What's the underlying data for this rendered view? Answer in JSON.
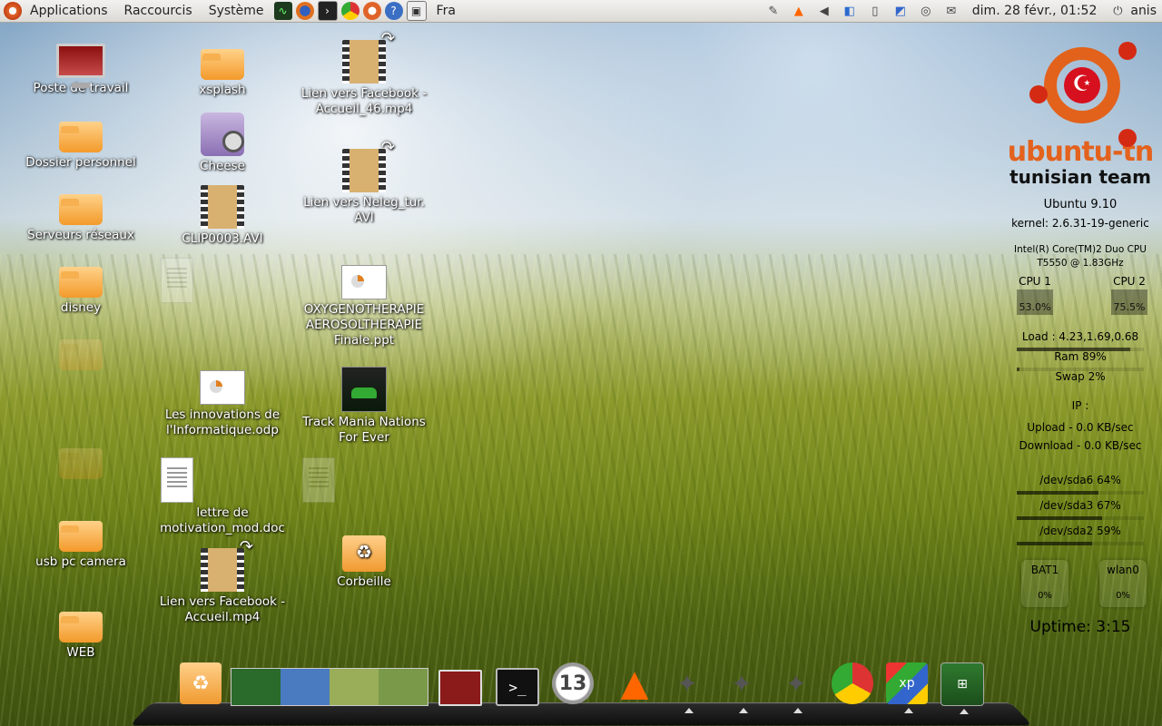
{
  "panel": {
    "menus": [
      "Applications",
      "Raccourcis",
      "Système"
    ],
    "launchers": [
      "system-monitor-icon",
      "firefox-icon",
      "terminal-icon",
      "chrome-icon",
      "ubuntu-tweak-icon",
      "help-icon",
      "screenshot-icon"
    ],
    "lang": "Fra",
    "datetime": "dim. 28 févr., 01:52",
    "user": "anis"
  },
  "desktop": {
    "icons": [
      {
        "label": "Poste de travail",
        "name": "computer-icon"
      },
      {
        "label": "Dossier personnel",
        "name": "home-folder-icon"
      },
      {
        "label": "Serveurs réseaux",
        "name": "network-folder-icon"
      },
      {
        "label": "disney",
        "name": "folder-icon"
      },
      {
        "label": "usb pc camera",
        "name": "folder-icon"
      },
      {
        "label": "WEB",
        "name": "folder-icon"
      },
      {
        "label": "xsplash",
        "name": "folder-icon"
      },
      {
        "label": "Cheese",
        "name": "webcam-icon"
      },
      {
        "label": "CLIP0003.AVI",
        "name": "video-icon"
      },
      {
        "label": "Les innovations de l'Informatique.odp",
        "name": "presentation-icon"
      },
      {
        "label": "lettre de motivation_mod.doc",
        "name": "document-icon"
      },
      {
        "label": "Lien vers Facebook - Accueil.mp4",
        "name": "video-link-icon"
      },
      {
        "label": "Lien vers Facebook - Accueil_46.mp4",
        "name": "video-link-icon"
      },
      {
        "label": "Lien vers Neleg_tur. AVI",
        "name": "video-link-icon"
      },
      {
        "label": "OXYGENOTHERAPIE AEROSOLTHERAPIE Finale.ppt",
        "name": "presentation-icon"
      },
      {
        "label": "Track Mania Nations For Ever",
        "name": "game-icon"
      },
      {
        "label": "Corbeille",
        "name": "trash-icon"
      }
    ]
  },
  "conky": {
    "brand": "ubuntu-tn",
    "brand_sub": "tunisian team",
    "os": "Ubuntu 9.10",
    "kernel": "kernel: 2.6.31-19-generic",
    "cpu_model": "Intel(R) Core(TM)2 Duo CPU",
    "cpu_model2": "T5550  @ 1.83GHz",
    "cpu1_label": "CPU 1",
    "cpu1_value": "53.0%",
    "cpu2_label": "CPU 2",
    "cpu2_value": "75.5%",
    "load": "Load : 4.23,1.69,0.68",
    "ram": "Ram 89%",
    "ram_pct": 89,
    "swap": "Swap 2%",
    "swap_pct": 2,
    "ip": "IP :",
    "upload": "Upload - 0.0 KB/sec",
    "download": "Download - 0.0 KB/sec",
    "sda6": "/dev/sda6 64%",
    "sda6_pct": 64,
    "sda3": "/dev/sda3 67%",
    "sda3_pct": 67,
    "sda2": "/dev/sda2 59%",
    "sda2_pct": 59,
    "bat_label": "BAT1",
    "bat_value": "0%",
    "wlan_label": "wlan0",
    "wlan_value": "0%",
    "uptime": "Uptime: 3:15"
  },
  "dock": {
    "clock_badge": "13",
    "items": [
      "trash-icon",
      "workspace-switcher-icon",
      "window-icon",
      "terminal-icon",
      "clock-icon",
      "vlc-icon",
      "gimp-icon",
      "gimp-icon",
      "gimp-icon",
      "chrome-icon",
      "windows-xp-icon",
      "network-icon"
    ]
  },
  "colors": {
    "accent": "#e3621d",
    "panel_bg": "#e8e6e2"
  }
}
